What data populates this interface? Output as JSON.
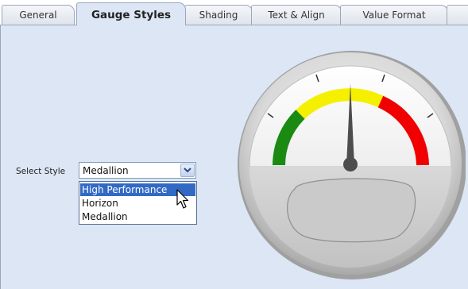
{
  "tabs": [
    "General",
    "Gauge Styles",
    "Shading",
    "Text & Align",
    "Value Format"
  ],
  "active_tab": "Gauge Styles",
  "style_selector": {
    "label": "Select Style",
    "current_value": "Medallion",
    "options": [
      "High Performance",
      "Horizon",
      "Medallion"
    ],
    "highlighted_option": "High Performance"
  },
  "gauge_preview": {
    "style": "medallion",
    "zones": [
      {
        "color": "#1a8a12",
        "name": "green"
      },
      {
        "color": "#f5ef00",
        "name": "yellow"
      },
      {
        "color": "#f00000",
        "name": "red"
      }
    ],
    "needle_fraction": 0.5
  },
  "colors": {
    "panel_bg": "#dde6f4",
    "selection": "#316ac5"
  },
  "icons": {
    "dropdown": "chevron-down-icon",
    "cursor": "arrow-cursor-icon"
  }
}
